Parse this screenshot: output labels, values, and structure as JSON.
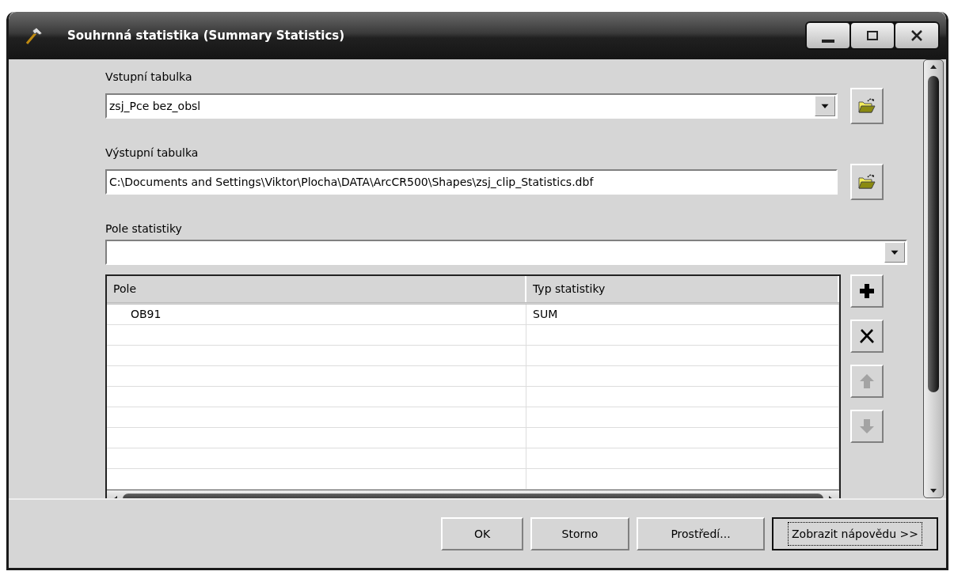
{
  "window": {
    "title": "Souhrnná statistika (Summary Statistics)"
  },
  "fields": [
    {
      "kind": "combo",
      "label": "Vstupní tabulka",
      "value": "zsj_Pce bez_obsl",
      "browse": true
    },
    {
      "kind": "text",
      "label": "Výstupní tabulka",
      "value": "C:\\Documents and Settings\\Viktor\\Plocha\\DATA\\ArcCR500\\Shapes\\zsj_clip_Statistics.dbf",
      "browse": true
    },
    {
      "kind": "combo",
      "label": "Pole statistiky",
      "browse": false
    }
  ],
  "stat_table": {
    "columns": [
      "Pole",
      "Typ statistiky"
    ],
    "rows": [
      [
        "OB91",
        "SUM"
      ]
    ]
  },
  "side_buttons": [
    {
      "kind": "add",
      "disabled": false
    },
    {
      "kind": "remove",
      "disabled": false
    },
    {
      "kind": "up",
      "disabled": true
    },
    {
      "kind": "down",
      "disabled": true
    }
  ],
  "buttons": [
    {
      "label": "OK",
      "focused": false
    },
    {
      "label": "Storno",
      "focused": false
    },
    {
      "label": "Prostředí...",
      "focused": false
    },
    {
      "label": "Zobrazit nápovědu >>",
      "focused": true
    }
  ]
}
